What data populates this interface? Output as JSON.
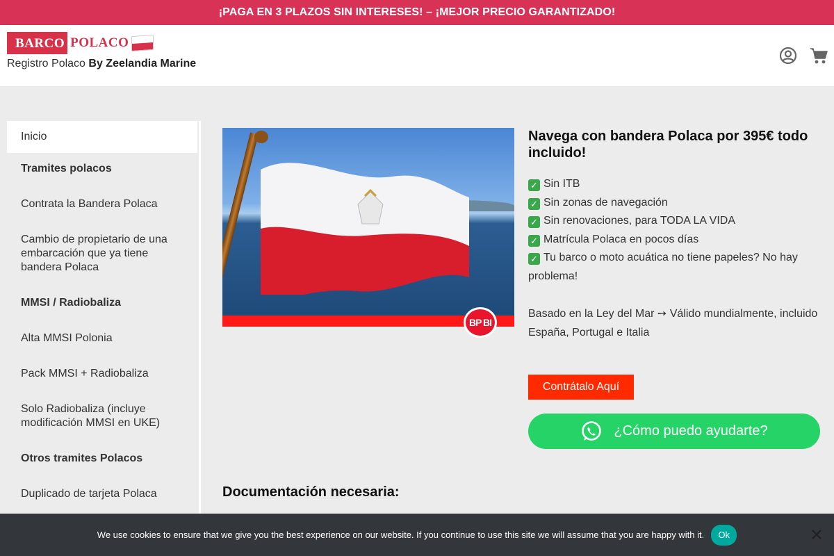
{
  "promo": {
    "text": "¡PAGA EN 3 PLAZOS SIN INTERESES! – ¡MEJOR PRECIO GARANTIZADO!"
  },
  "header": {
    "logo_barco": "BARCO",
    "logo_polaco": "POLACO",
    "tagline_prefix": "Registro Polaco ",
    "tagline_bold": "By Zeelandia Marine",
    "icons": [
      "user-circle-icon",
      "cart-icon"
    ]
  },
  "sidebar": {
    "items": [
      {
        "label": "Inicio"
      },
      {
        "label": "Tramites polacos"
      },
      {
        "label": "Contrata la Bandera Polaca"
      },
      {
        "label": "Cambio de propietario de una embarcación que ya tiene bandera Polaca"
      },
      {
        "label": "MMSI / Radiobaliza"
      },
      {
        "label": "Alta MMSI Polonia"
      },
      {
        "label": "Pack MMSI + Radiobaliza"
      },
      {
        "label": "Solo Radiobaliza (incluye modificación MMSI en UKE)"
      },
      {
        "label": "Otros tramites Polacos"
      },
      {
        "label": "Duplicado de tarjeta Polaca"
      }
    ]
  },
  "hero": {
    "badge": "BP BI",
    "image": "polish-flag-on-boat-photo"
  },
  "main": {
    "title": "Navega con bandera Polaca por 395€ todo incluido!",
    "features": [
      "Sin ITB",
      "Sin zonas de navegación",
      "Sin renovaciones, para TODA LA VIDA",
      "Matrícula Polaca en pocos días",
      "Tu barco o moto acuática no tiene papeles? No hay problema!"
    ],
    "law_text": "Basado en la Ley del Mar ➙ Válido mundialmente, incluido España, Portugal e Italia",
    "cta_label": "Contrátalo Aquí",
    "whatsapp_label": "¿Cómo puedo ayudarte?",
    "doc_heading": "Documentación necesaria:"
  },
  "cookie": {
    "text": "We use cookies to ensure that we give you the best experience on our website. If you continue to use this site we will assume that you are happy with it.",
    "ok_label": "Ok"
  },
  "colors": {
    "brand_red": "#d8324a",
    "promo_bg": "#d83257",
    "cta_bg": "#ff2a00",
    "whatsapp_green": "#25d366",
    "cookie_bg": "#33363b",
    "cookie_ok": "#00a99d"
  }
}
